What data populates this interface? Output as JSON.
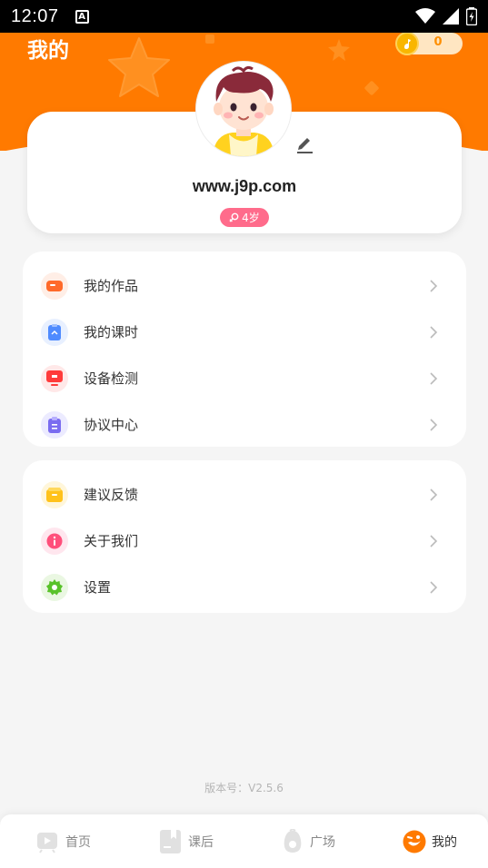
{
  "status_bar": {
    "time": "12:07",
    "keyboard_indicator": "A"
  },
  "header": {
    "title": "我的",
    "coin_count": "0"
  },
  "profile": {
    "name": "www.j9p.com",
    "age": "4岁"
  },
  "menu_group_1": [
    {
      "label": "我的作品",
      "icon": "works-icon",
      "color": "#ff6a2a"
    },
    {
      "label": "我的课时",
      "icon": "lesson-hours-icon",
      "color": "#4f8bff"
    },
    {
      "label": "设备检测",
      "icon": "device-check-icon",
      "color": "#ff3b3b"
    },
    {
      "label": "协议中心",
      "icon": "agreement-icon",
      "color": "#7a6cf0"
    }
  ],
  "menu_group_2": [
    {
      "label": "建议反馈",
      "icon": "feedback-icon",
      "color": "#ffc21a"
    },
    {
      "label": "关于我们",
      "icon": "info-icon",
      "color": "#ff4f7b"
    },
    {
      "label": "设置",
      "icon": "settings-gear-icon",
      "color": "#59c22a"
    }
  ],
  "version": "版本号：V2.5.6",
  "tabs": [
    {
      "label": "首页",
      "icon": "home-play-icon",
      "active": false
    },
    {
      "label": "课后",
      "icon": "after-class-book-icon",
      "active": false
    },
    {
      "label": "广场",
      "icon": "plaza-icon",
      "active": false
    },
    {
      "label": "我的",
      "icon": "profile-face-icon",
      "active": true
    }
  ],
  "colors": {
    "brand_orange": "#ff7a00",
    "age_badge": "#ff6b8b",
    "background": "#f5f5f5"
  }
}
